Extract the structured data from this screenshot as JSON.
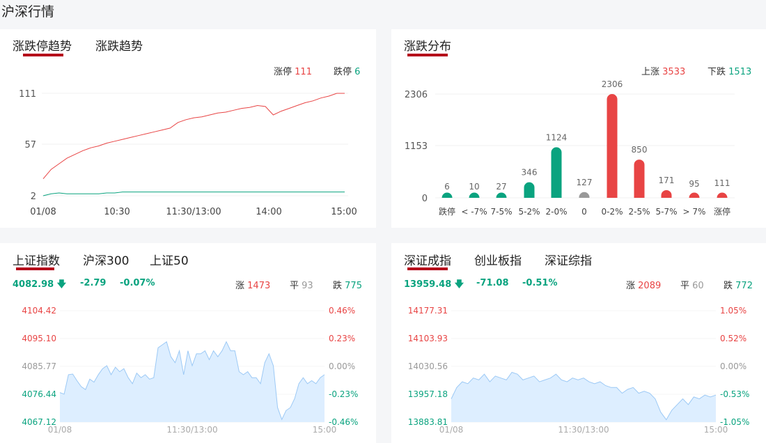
{
  "page_title": "沪深行情",
  "limit_panel": {
    "tabs": [
      "涨跌停趋势",
      "涨跌趋势"
    ],
    "limit_up_label": "涨停",
    "limit_up": "111",
    "limit_down_label": "跌停",
    "limit_down": "6"
  },
  "dist_panel": {
    "tabs": [
      "涨跌分布"
    ],
    "up_label": "上涨",
    "up": "3533",
    "down_label": "下跌",
    "down": "1513"
  },
  "sh_panel": {
    "tabs": [
      "上证指数",
      "沪深300",
      "上证50"
    ],
    "price": "4082.98",
    "change": "-2.79",
    "pct": "-0.07%",
    "rise_label": "涨",
    "rise": "1473",
    "flat_label": "平",
    "flat": "93",
    "fall_label": "跌",
    "fall": "775"
  },
  "sz_panel": {
    "tabs": [
      "深证成指",
      "创业板指",
      "深证综指"
    ],
    "price": "13959.48",
    "change": "-71.08",
    "pct": "-0.51%",
    "rise_label": "涨",
    "rise": "2089",
    "flat_label": "平",
    "flat": "60",
    "fall_label": "跌",
    "fall": "772"
  },
  "colors": {
    "red": "#e84444",
    "green": "#0aa37f",
    "gray": "#999999",
    "accent": "#b5001a",
    "area": "#ddeeff",
    "line": "#9cc9f5"
  },
  "chart_data": [
    {
      "type": "line",
      "title": "涨跌停趋势",
      "yticks": [
        "111",
        "57",
        "2"
      ],
      "ylim": [
        2,
        111
      ],
      "xticks": [
        "01/08",
        "10:30",
        "11:30/13:00",
        "14:00",
        "15:00"
      ],
      "series": [
        {
          "name": "涨停",
          "color": "#e84444",
          "values": [
            20,
            30,
            36,
            42,
            46,
            50,
            53,
            55,
            58,
            60,
            62,
            64,
            66,
            68,
            70,
            72,
            74,
            80,
            83,
            85,
            86,
            88,
            90,
            91,
            93,
            95,
            96,
            98,
            97,
            88,
            92,
            95,
            98,
            101,
            103,
            106,
            108,
            111,
            111
          ]
        },
        {
          "name": "跌停",
          "color": "#0aa37f",
          "values": [
            2,
            4,
            5,
            4,
            4,
            4,
            4,
            4,
            5,
            5,
            6,
            6,
            6,
            6,
            6,
            6,
            6,
            6,
            6,
            6,
            6,
            6,
            6,
            6,
            6,
            6,
            6,
            6,
            6,
            6,
            6,
            6,
            6,
            6,
            6,
            6,
            6,
            6,
            6
          ]
        }
      ]
    },
    {
      "type": "bar",
      "title": "涨跌分布",
      "categories": [
        "跌停",
        "< -7%",
        "7-5%",
        "5-2%",
        "2-0%",
        "0",
        "0-2%",
        "2-5%",
        "5-7%",
        "> 7%",
        "涨停"
      ],
      "values": [
        6,
        10,
        27,
        346,
        1124,
        127,
        2306,
        850,
        171,
        95,
        111
      ],
      "colors": [
        "#0aa37f",
        "#0aa37f",
        "#0aa37f",
        "#0aa37f",
        "#0aa37f",
        "#999999",
        "#e84444",
        "#e84444",
        "#e84444",
        "#e84444",
        "#e84444"
      ],
      "yticks": [
        "2306",
        "1153",
        "0"
      ],
      "ylim": [
        0,
        2306
      ]
    },
    {
      "type": "area",
      "title": "上证指数",
      "ylim": [
        4067.12,
        4104.42
      ],
      "yticks": [
        "4104.42",
        "4095.10",
        "4085.77",
        "4076.44",
        "4067.12"
      ],
      "yticks_right": [
        "0.46%",
        "0.23%",
        "0.00%",
        "-0.23%",
        "-0.46%"
      ],
      "xticks": [
        "01/08",
        "11:30/13:00",
        "15:00"
      ],
      "values": [
        4077,
        4076.5,
        4083,
        4083.2,
        4081,
        4079,
        4078,
        4081.5,
        4080.5,
        4083,
        4085,
        4086,
        4083,
        4085.5,
        4084,
        4085,
        4082,
        4080,
        4083.5,
        4082,
        4083,
        4081.5,
        4082,
        4092,
        4093,
        4094,
        4089,
        4087,
        4091,
        4083,
        4091,
        4086,
        4090,
        4090,
        4091,
        4088,
        4091,
        4089,
        4091,
        4094,
        4091,
        4091,
        4084,
        4083,
        4084,
        4082,
        4082,
        4080,
        4087,
        4090,
        4086,
        4072,
        4068,
        4071,
        4072,
        4075,
        4080,
        4082,
        4080,
        4081,
        4080,
        4082,
        4083
      ]
    },
    {
      "type": "area",
      "title": "深证成指",
      "ylim": [
        13883.81,
        14177.31
      ],
      "yticks": [
        "14177.31",
        "14103.93",
        "14030.56",
        "13957.18",
        "13883.81"
      ],
      "yticks_right": [
        "1.05%",
        "0.52%",
        "0.00%",
        "-0.53%",
        "-1.05%"
      ],
      "xticks": [
        "01/08",
        "11:30/13:00",
        "15:00"
      ],
      "values": [
        13945,
        13975,
        13990,
        13985,
        14000,
        13995,
        14010,
        13990,
        14005,
        14000,
        13995,
        14015,
        14010,
        13995,
        14000,
        14005,
        13990,
        13995,
        14000,
        14010,
        13995,
        13990,
        14000,
        13995,
        14000,
        13990,
        13985,
        13990,
        13980,
        13975,
        13975,
        13960,
        13970,
        13975,
        13960,
        13965,
        13960,
        13945,
        13910,
        13890,
        13915,
        13930,
        13945,
        13930,
        13950,
        13945,
        13955,
        13950,
        13955
      ]
    }
  ]
}
